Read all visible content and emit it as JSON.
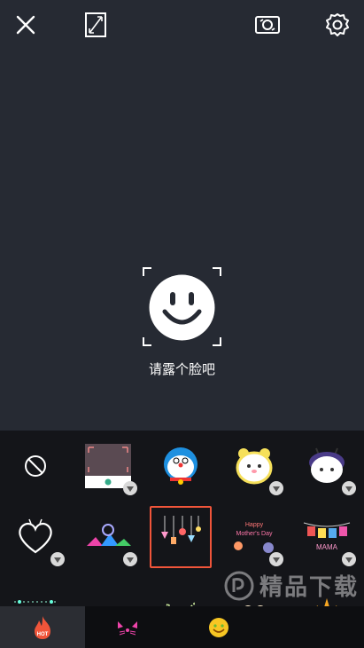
{
  "camera": {
    "hint_text": "请露个脸吧"
  },
  "toolbar": {
    "icons": [
      "close-icon",
      "aspect-ratio-icon",
      "flip-camera-icon",
      "settings-icon"
    ]
  },
  "stickers": {
    "items": [
      {
        "name": "none",
        "icon": "no-sticker-icon"
      },
      {
        "name": "frame",
        "icon": "frame-sticker"
      },
      {
        "name": "doraemon",
        "icon": "doraemon-sticker"
      },
      {
        "name": "cat-bear",
        "icon": "cat-sticker"
      },
      {
        "name": "bee-cat",
        "icon": "bee-sticker"
      },
      {
        "name": "heart",
        "icon": "heart-sticker"
      },
      {
        "name": "hats",
        "icon": "hats-sticker"
      },
      {
        "name": "hanging-charms",
        "icon": "charms-sticker"
      },
      {
        "name": "mothers-day",
        "text": "Happy Mother's Day"
      },
      {
        "name": "mama-banner",
        "text": "MAMA"
      },
      {
        "name": "lights",
        "icon": "lights-sticker"
      },
      {
        "name": "script-text",
        "text": "rosiea"
      },
      {
        "name": "cat-ears",
        "icon": "cat-ears-sticker"
      },
      {
        "name": "flower",
        "icon": "flower-sticker"
      },
      {
        "name": "crown",
        "icon": "crown-sticker"
      }
    ]
  },
  "tabs": [
    {
      "name": "hot",
      "label": "HOT"
    },
    {
      "name": "cat-face",
      "icon": "cat-face-icon"
    },
    {
      "name": "emoji",
      "icon": "emoji-icon"
    },
    {
      "name": "more",
      "icon": "more-icon"
    }
  ],
  "watermark": {
    "text": "精品下载"
  },
  "colors": {
    "camera_bg": "#262a33",
    "panel_bg": "#141519",
    "selected_border": "#f0553a",
    "hot_flame": "#f0553a"
  }
}
